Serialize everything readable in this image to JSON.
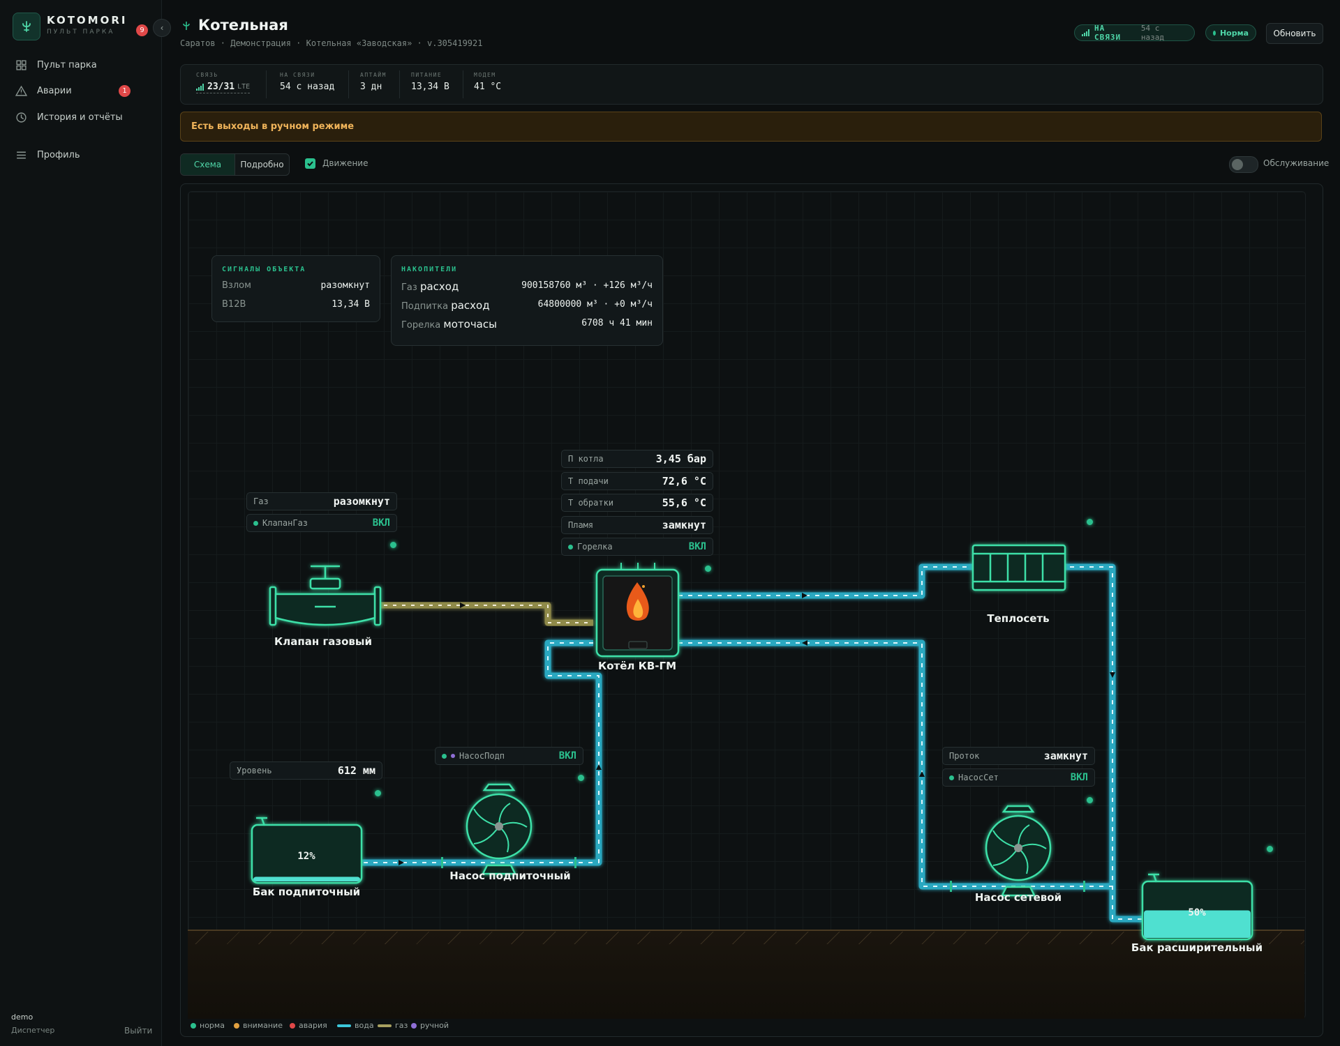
{
  "sidebar": {
    "brand": "KOTOMORI",
    "brand_sub": "ПУЛЬТ ПАРКА",
    "notifications": "9",
    "items": [
      {
        "label": "Пульт парка"
      },
      {
        "label": "Аварии",
        "badge": "1"
      },
      {
        "label": "История и отчёты"
      },
      {
        "label": "Профиль"
      }
    ],
    "user": "demo",
    "role": "Диспетчер",
    "logout": "Выйти"
  },
  "header": {
    "title": "Котельная",
    "breadcrumb": "Саратов · Демонстрация · Котельная «Заводская» · v.305419921",
    "online_label": "НА СВЯЗИ",
    "online_ago": "54 с назад",
    "status": "Норма",
    "refresh": "Обновить"
  },
  "stats": [
    {
      "label": "СВЯЗЬ",
      "value": "23/31",
      "suffix": "LTE"
    },
    {
      "label": "НА СВЯЗИ",
      "value": "54 с назад"
    },
    {
      "label": "АПТАЙМ",
      "value": "3 дн"
    },
    {
      "label": "ПИТАНИЕ",
      "value": "13,34 В"
    },
    {
      "label": "МОДЕМ",
      "value": "41 °C"
    }
  ],
  "warning": "Есть выходы в ручном режиме",
  "tabs": [
    {
      "label": "Схема",
      "active": true
    },
    {
      "label": "Подробно",
      "active": false
    }
  ],
  "motion": {
    "label": "Движение",
    "checked": true
  },
  "maintenance": {
    "label": "Обслуживание",
    "on": false
  },
  "signals": {
    "title": "СИГНАЛЫ ОБЪЕКТА",
    "rows": [
      {
        "k": "Взлом",
        "v": "разомкнут"
      },
      {
        "k": "В12В",
        "v": "13,34 В"
      }
    ]
  },
  "accumulators": {
    "title": "НАКОПИТЕЛИ",
    "rows": [
      {
        "k": "Газ",
        "m": "расход",
        "v": "900158760 м³ · +126 м³/ч"
      },
      {
        "k": "Подпитка",
        "m": "расход",
        "v": "64800000 м³ · +0 м³/ч"
      },
      {
        "k": "Горелка",
        "m": "моточасы",
        "v": "6708 ч 41 мин"
      }
    ]
  },
  "boiler": {
    "label": "Котёл КВ-ГМ",
    "readings": [
      {
        "k": "П котла",
        "v": "3,45 бар"
      },
      {
        "k": "Т подачи",
        "v": "72,6 °C"
      },
      {
        "k": "Т обратки",
        "v": "55,6 °C"
      },
      {
        "k": "Пламя",
        "v": "замкнут"
      },
      {
        "k": "Горелка",
        "v": "ВКЛ"
      }
    ]
  },
  "gas_valve": {
    "label": "Клапан газовый",
    "readings": [
      {
        "k": "Газ",
        "v": "разомкнут"
      },
      {
        "k": "КлапанГаз",
        "v": "ВКЛ"
      }
    ]
  },
  "heat_network": {
    "label": "Теплосеть"
  },
  "feed_tank": {
    "label": "Бак подпиточный",
    "level_k": "Уровень",
    "level_v": "612 мм",
    "percent": "12%",
    "fill": 0.12
  },
  "feed_pump": {
    "label": "Насос подпиточный",
    "k": "НасосПодп",
    "v": "ВКЛ"
  },
  "net_pump": {
    "label": "Насос сетевой",
    "flow_k": "Проток",
    "flow_v": "замкнут",
    "k": "НасосСет",
    "v": "ВКЛ"
  },
  "exp_tank": {
    "label": "Бак расширительный",
    "percent": "50%",
    "fill": 0.5
  },
  "legend": [
    {
      "label": "норма",
      "color": "#2bc08e",
      "kind": "dot"
    },
    {
      "label": "внимание",
      "color": "#e0a040",
      "kind": "dot"
    },
    {
      "label": "авария",
      "color": "#e04848",
      "kind": "dot"
    },
    {
      "label": "вода",
      "color": "#3cc8dc",
      "kind": "line"
    },
    {
      "label": "газ",
      "color": "#a8a060",
      "kind": "line"
    },
    {
      "label": "ручной",
      "color": "#8f6fd6",
      "kind": "dot"
    }
  ]
}
